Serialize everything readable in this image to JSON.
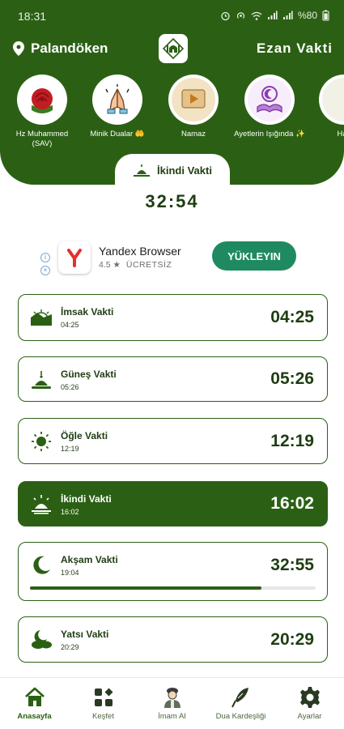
{
  "status_bar": {
    "time": "18:31",
    "battery": "%80"
  },
  "header": {
    "location": "Palandöken",
    "title": "Ezan Vakti"
  },
  "stories": [
    {
      "label": "Hz Muhammed (SAV)",
      "icon": "rose-icon"
    },
    {
      "label": "Minik Dualar 🤲",
      "icon": "praying-hands-icon"
    },
    {
      "label": "Namaz",
      "icon": "video-icon"
    },
    {
      "label": "Ayetlerin Işığında ✨",
      "icon": "quran-icon"
    },
    {
      "label": "Hay",
      "icon": "story-icon"
    }
  ],
  "current": {
    "label": "İkindi Vakti",
    "countdown": "32:54"
  },
  "ad": {
    "title": "Yandex Browser",
    "rating": "4.5 ★",
    "price": "ÜCRETSİZ",
    "cta": "YÜKLEYIN"
  },
  "prayers": [
    {
      "name": "İmsak Vakti",
      "small": "04:25",
      "time": "04:25",
      "icon": "dawn-icon"
    },
    {
      "name": "Güneş Vakti",
      "small": "05:26",
      "time": "05:26",
      "icon": "mosque-sun-icon"
    },
    {
      "name": "Öğle Vakti",
      "small": "12:19",
      "time": "12:19",
      "icon": "sun-icon"
    },
    {
      "name": "İkindi Vakti",
      "small": "16:02",
      "time": "16:02",
      "icon": "afternoon-icon",
      "active": true
    },
    {
      "name": "Akşam Vakti",
      "small": "19:04",
      "time": "32:55",
      "icon": "crescent-icon",
      "progress": 0.81
    },
    {
      "name": "Yatsı Vakti",
      "small": "20:29",
      "time": "20:29",
      "icon": "night-clouds-icon"
    }
  ],
  "nav": [
    {
      "label": "Anasayfa",
      "icon": "home-icon",
      "active": true
    },
    {
      "label": "Keşfet",
      "icon": "grid-icon"
    },
    {
      "label": "İmam AI",
      "icon": "imam-icon"
    },
    {
      "label": "Dua Kardeşliği",
      "icon": "quill-icon"
    },
    {
      "label": "Ayarlar",
      "icon": "gear-icon"
    }
  ],
  "colors": {
    "primary": "#2b6014",
    "ad_button": "#1f8a62",
    "progress_track": "#e6e6e6"
  }
}
